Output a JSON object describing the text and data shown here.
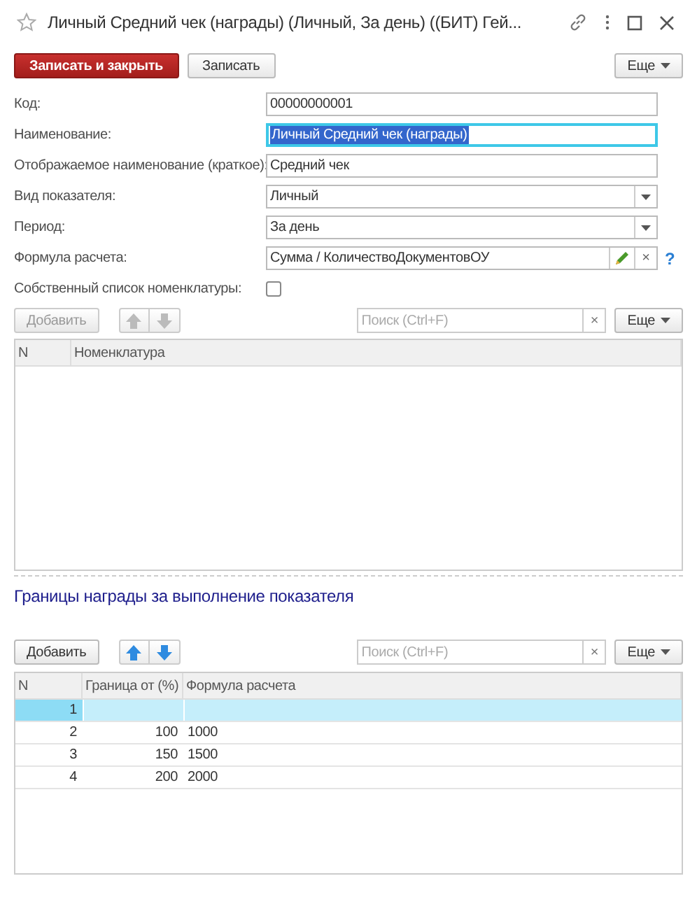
{
  "window": {
    "title": "Личный Средний чек (награды) (Личный, За день) ((БИТ) Гей..."
  },
  "toolbar": {
    "buttons": [
      {
        "label": "Записать и закрыть",
        "kind": "primary"
      },
      {
        "label": "Записать",
        "kind": "default"
      }
    ],
    "more": "Еще"
  },
  "fields": [
    {
      "label": "Код:",
      "kind": "text",
      "value": "00000000001",
      "focused": false
    },
    {
      "label": "Наименование:",
      "kind": "text",
      "value": "Личный Средний чек (награды)",
      "focused": true
    },
    {
      "label": "Отображаемое наименование (краткое):",
      "kind": "text",
      "value": "Средний чек",
      "focused": false
    },
    {
      "label": "Вид показателя:",
      "kind": "select",
      "value": "Личный",
      "focused": false
    },
    {
      "label": "Период:",
      "kind": "select",
      "value": "За день",
      "focused": false
    },
    {
      "label": "Формула расчета:",
      "kind": "formula",
      "value": "Сумма / КоличествоДокументовОУ",
      "clear": "×",
      "help": "?",
      "focused": false
    },
    {
      "label": "Собственный список номенклатуры:",
      "kind": "checkbox",
      "checked": false
    }
  ],
  "items_table": {
    "toolbar": {
      "add": "Добавить",
      "disabled": true,
      "search_placeholder": "Поиск (Ctrl+F)",
      "clear": "×",
      "more": "Еще"
    },
    "columns": [
      "N",
      "Номенклатура"
    ]
  },
  "section_title": "Границы награды за выполнение показателя",
  "bounds_table": {
    "toolbar": {
      "add": "Добавить",
      "disabled": false,
      "search_placeholder": "Поиск (Ctrl+F)",
      "clear": "×",
      "more": "Еще"
    },
    "columns": [
      "N",
      "Граница от (%)",
      "Формула расчета"
    ],
    "rows": [
      {
        "n": "1",
        "selected": true
      },
      {
        "n": "2",
        "from": "100",
        "formula": "1000",
        "selected": false
      },
      {
        "n": "3",
        "from": "150",
        "formula": "1500",
        "selected": false
      },
      {
        "n": "4",
        "from": "200",
        "formula": "2000",
        "selected": false
      }
    ]
  }
}
